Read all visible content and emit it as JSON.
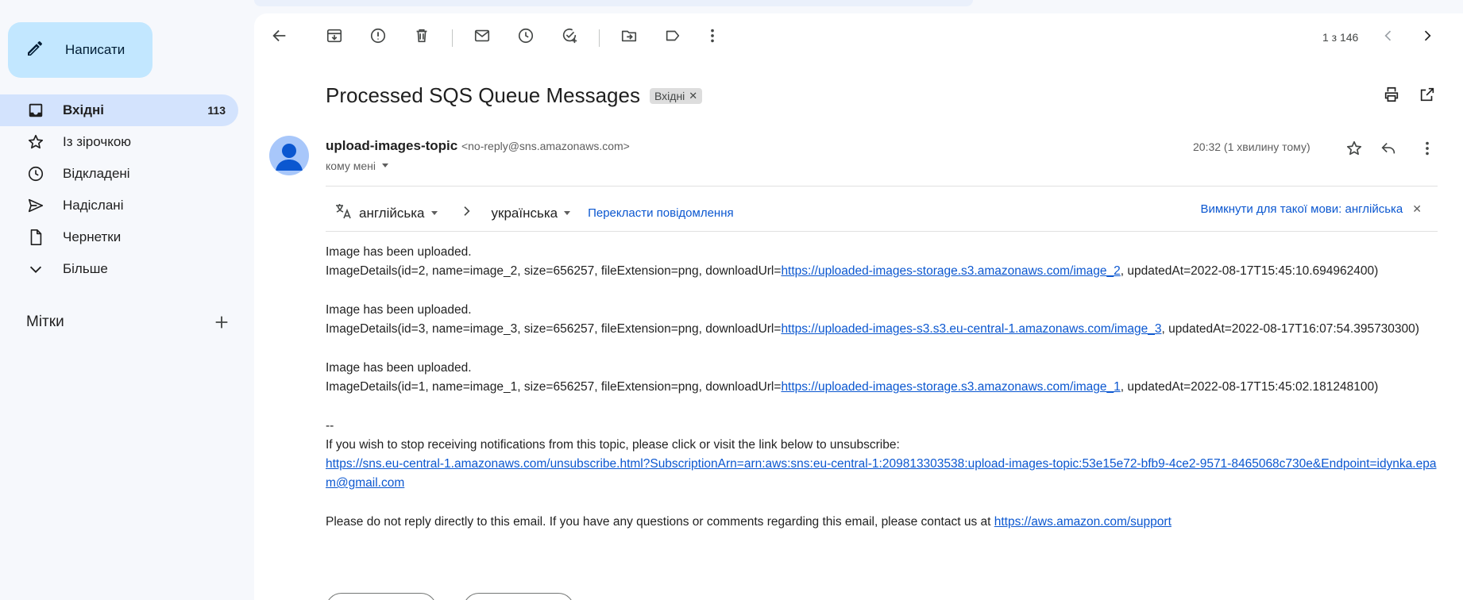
{
  "sidebar": {
    "compose_label": "Написати",
    "items": [
      {
        "label": "Вхідні",
        "count": "113",
        "icon": "inbox-icon"
      },
      {
        "label": "Із зірочкою",
        "count": "",
        "icon": "star-icon"
      },
      {
        "label": "Відкладені",
        "count": "",
        "icon": "clock-icon"
      },
      {
        "label": "Надіслані",
        "count": "",
        "icon": "send-icon"
      },
      {
        "label": "Чернетки",
        "count": "",
        "icon": "draft-icon"
      },
      {
        "label": "Більше",
        "count": "",
        "icon": "chevron-down-icon"
      }
    ],
    "labels_title": "Мітки"
  },
  "toolbar": {
    "pager": "1 з 146"
  },
  "email": {
    "subject": "Processed SQS Queue Messages",
    "tag": "Вхідні",
    "sender_name": "upload-images-topic",
    "sender_address": "<no-reply@sns.amazonaws.com>",
    "to": "кому мені",
    "time": "20:32 (1 хвилину тому)"
  },
  "translate": {
    "from_lang": "англійська",
    "to_lang": "українська",
    "translate_link": "Перекласти повідомлення",
    "turn_off": "Вимкнути для такої мови: англійська"
  },
  "body": {
    "msg1_title": "Image has been uploaded.",
    "msg1_prefix": "ImageDetails(id=2, name=image_2, size=656257, fileExtension=png, downloadUrl=",
    "msg1_link": "https://uploaded-images-storage.s3.amazonaws.com/image_2",
    "msg1_suffix": ", updatedAt=2022-08-17T15:45:10.694962400)",
    "msg2_title": "Image has been uploaded.",
    "msg2_prefix": "ImageDetails(id=3, name=image_3, size=656257, fileExtension=png, downloadUrl=",
    "msg2_link": "https://uploaded-images-s3.s3.eu-central-1.amazonaws.com/image_3",
    "msg2_suffix": ", updatedAt=2022-08-17T16:07:54.395730300)",
    "msg3_title": "Image has been uploaded.",
    "msg3_prefix": "ImageDetails(id=1, name=image_1, size=656257, fileExtension=png, downloadUrl=",
    "msg3_link": "https://uploaded-images-storage.s3.amazonaws.com/image_1",
    "msg3_suffix": ", updatedAt=2022-08-17T15:45:02.181248100)",
    "sig_sep": "--",
    "unsub_text": "If you wish to stop receiving notifications from this topic, please click or visit the link below to unsubscribe:",
    "unsub_link": "https://sns.eu-central-1.amazonaws.com/unsubscribe.html?SubscriptionArn=arn:aws:sns:eu-central-1:209813303538:upload-images-topic:53e15e72-bfb9-4ce2-9571-8465068c730e&Endpoint=idynka.epam@gmail.com",
    "support_text": "Please do not reply directly to this email. If you have any questions or comments regarding this email, please contact us at ",
    "support_link": "https://aws.amazon.com/support"
  }
}
